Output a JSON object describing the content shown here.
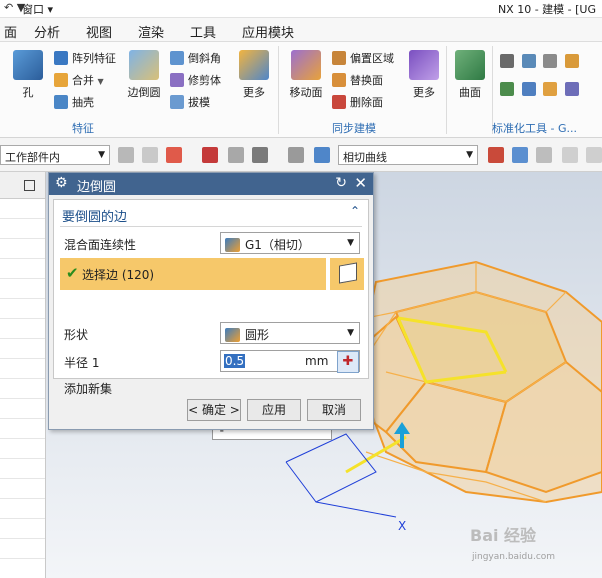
{
  "titlebar": {
    "quick": "↶ ▼",
    "window_menu": "窗口 ▾",
    "app_title": "NX 10 - 建模 - [UG"
  },
  "menubar": {
    "items": [
      "面",
      "分析",
      "视图",
      "渲染",
      "工具",
      "应用模块"
    ]
  },
  "ribbon": {
    "feature": {
      "hole": "孔",
      "pattern": "阵列特征",
      "unite": "合并",
      "shell": "抽壳",
      "edge_blend": "边倒圆",
      "chamfer": "倒斜角",
      "trim": "修剪体",
      "draft": "拔模",
      "more": "更多",
      "group": "特征"
    },
    "sync": {
      "move_face": "移动面",
      "offset_region": "偏置区域",
      "replace_face": "替换面",
      "delete_face": "删除面",
      "more": "更多",
      "group": "同步建模"
    },
    "surface": {
      "label": "曲面"
    },
    "standard": {
      "group": "标准化工具 - G..."
    }
  },
  "toolbar2": {
    "scope": "工作部件内",
    "curve_rule": "相切曲线"
  },
  "dialog": {
    "title": "边倒圆",
    "section_title": "要倒圆的边",
    "blend_label": "混合面连续性",
    "blend_value": "G1（相切）",
    "select_edge": "选择边 (120)",
    "shape_label": "形状",
    "shape_value": "圆形",
    "radius_label": "半径 1",
    "radius_value": "0.5",
    "radius_unit": "mm",
    "add_set_label": "添加新集",
    "ok": "< 确定 >",
    "apply": "应用",
    "cancel": "取消"
  },
  "viewport": {
    "axis_x": "X",
    "watermark": "Bai 经验",
    "watermark_sub": "jingyan.baidu.com"
  }
}
